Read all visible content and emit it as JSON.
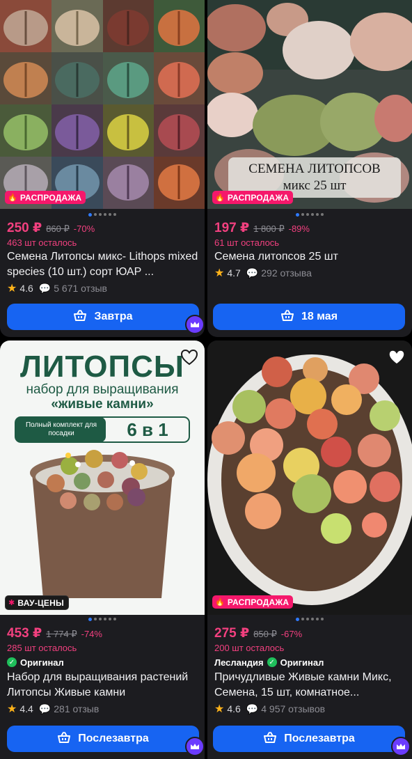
{
  "products": [
    {
      "badge": "РАСПРОДАЖА",
      "price": "250 ₽",
      "old_price": "860 ₽",
      "discount": "-70%",
      "stock": "463 шт осталось",
      "title": "Семена Литопсы микс- Lithops mixed species (10 шт.) сорт ЮАР ...",
      "rating": "4.6",
      "reviews": "5 671 отзыв",
      "button": "Завтра"
    },
    {
      "badge": "РАСПРОДАЖА",
      "image_caption_line1": "СЕМЕНА ЛИТОПСОВ",
      "image_caption_line2": "микс 25 шт",
      "price": "197 ₽",
      "old_price": "1 800 ₽",
      "discount": "-89%",
      "stock": "61 шт осталось",
      "title": "Семена литопсов 25 шт",
      "rating": "4.7",
      "reviews": "292 отзыва",
      "button": "18 мая"
    },
    {
      "badge": "ВАУ-ЦЕНЫ",
      "image_title": "ЛИТОПСЫ",
      "image_sub1": "набор для выращивания",
      "image_sub2": "«живые камни»",
      "image_pill": "Полный комплект для посадки",
      "image_count": "6 в 1",
      "price": "453 ₽",
      "old_price": "1 774 ₽",
      "discount": "-74%",
      "stock": "285 шт осталось",
      "original": "Оригинал",
      "title": "Набор для выращивания растений Литопсы Живые камни",
      "rating": "4.4",
      "reviews": "281 отзыв",
      "button": "Послезавтра"
    },
    {
      "badge": "РАСПРОДАЖА",
      "price": "275 ₽",
      "old_price": "850 ₽",
      "discount": "-67%",
      "stock": "200 шт осталось",
      "brand": "Лесландия",
      "original": "Оригинал",
      "title": "Причудливые Живые камни Микс, Семена, 15 шт, комнатное...",
      "rating": "4.6",
      "reviews": "4 957 отзывов",
      "button": "Послезавтра"
    }
  ],
  "colors": {
    "accent_pink": "#f2407f",
    "button_blue": "#1764f2",
    "star": "#ffb31a",
    "original_green": "#1fbf5b"
  },
  "icons": [
    "fire-icon",
    "heart-icon",
    "star-icon",
    "comment-icon",
    "cart-icon",
    "crown-icon",
    "check-icon"
  ]
}
